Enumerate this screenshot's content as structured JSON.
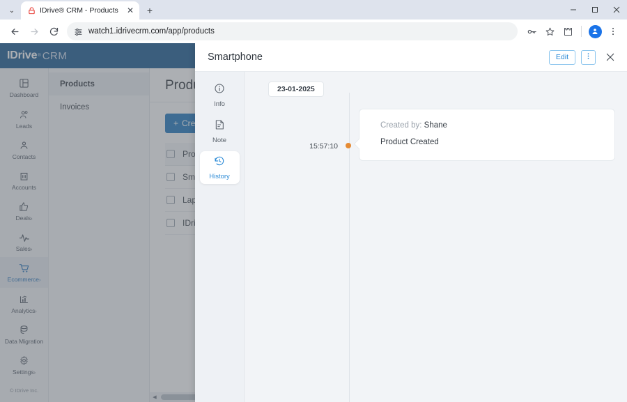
{
  "browser": {
    "tab": {
      "title": "IDrive® CRM - Products",
      "favicon_icon": "lock-icon",
      "close_icon": "✕"
    },
    "tab_list_chevron": "⌄",
    "new_tab_label": "+",
    "window_controls": {
      "minimize": "—",
      "maximize": "▢",
      "close": "✕"
    },
    "nav": {
      "back": "←",
      "forward": "→",
      "reload": "⟳"
    },
    "omnibox": {
      "url": "watch1.idrivecrm.com/app/products",
      "site_icon": "tune-icon"
    },
    "toolbar_icons": {
      "password_key": "key-icon",
      "bookmark": "star-icon",
      "extensions": "puzzle-icon",
      "profile": "avatar-icon",
      "menu": "kebab-icon"
    }
  },
  "app": {
    "logo": {
      "idrive": "IDrive",
      "reg": "®",
      "crm": "CRM"
    },
    "sidebar": {
      "items": [
        {
          "label": "Dashboard",
          "icon": "dashboard-icon",
          "caret": "",
          "active": false
        },
        {
          "label": "Leads",
          "icon": "leads-icon",
          "caret": "",
          "active": false
        },
        {
          "label": "Contacts",
          "icon": "contact-icon",
          "caret": "",
          "active": false
        },
        {
          "label": "Accounts",
          "icon": "accounts-icon",
          "caret": "",
          "active": false
        },
        {
          "label": "Deals",
          "icon": "thumbsup-icon",
          "caret": "›",
          "active": false
        },
        {
          "label": "Sales",
          "icon": "pulse-icon",
          "caret": "›",
          "active": false
        },
        {
          "label": "Ecommerce",
          "icon": "cart-icon",
          "caret": "›",
          "active": true
        },
        {
          "label": "Analytics",
          "icon": "analytics-icon",
          "caret": "›",
          "active": false
        },
        {
          "label": "Data Migration",
          "icon": "database-icon",
          "caret": "",
          "active": false
        },
        {
          "label": "Settings",
          "icon": "gear-icon",
          "caret": "›",
          "active": false
        }
      ],
      "footer": "© IDrive Inc."
    },
    "submenu": {
      "items": [
        "Products",
        "Invoices"
      ]
    },
    "content": {
      "title": "Products",
      "create_button": "Create P",
      "create_icon": "plus-icon",
      "rows": [
        "Produ",
        "Smar",
        "Lapto",
        "IDrive"
      ]
    },
    "scrollbar": {
      "left_arrow": "◀"
    }
  },
  "panel": {
    "title": "Smartphone",
    "edit_label": "Edit",
    "kebab_icon": "kebab-icon",
    "close_icon": "✕",
    "tabs": [
      {
        "label": "Info",
        "icon": "info-icon",
        "active": false
      },
      {
        "label": "Note",
        "icon": "note-icon",
        "active": false
      },
      {
        "label": "History",
        "icon": "history-icon",
        "active": true
      }
    ],
    "history": {
      "date": "23-01-2025",
      "entries": [
        {
          "time": "15:57:10",
          "created_by_label": "Created by:",
          "created_by_value": "Shane",
          "action": "Product Created",
          "dot_color": "#e58a33"
        }
      ]
    }
  }
}
